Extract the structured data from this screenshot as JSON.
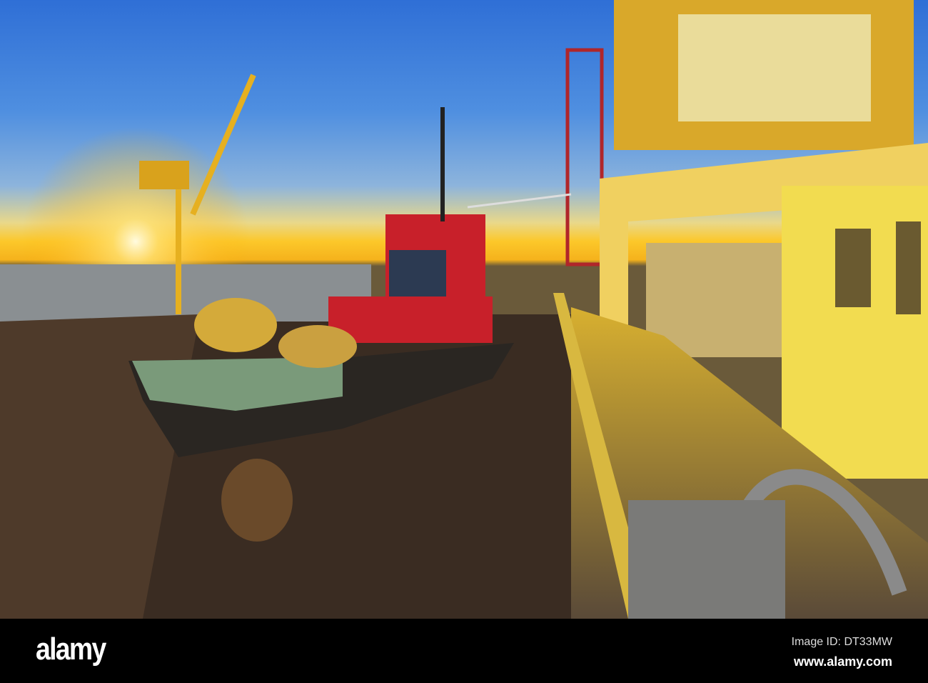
{
  "photo": {
    "subject": "Tugboat in floating dry dock at sunset"
  },
  "watermark": {
    "logo": "alamy",
    "image_id": "Image ID: DT33MW",
    "site": "www.alamy.com"
  }
}
